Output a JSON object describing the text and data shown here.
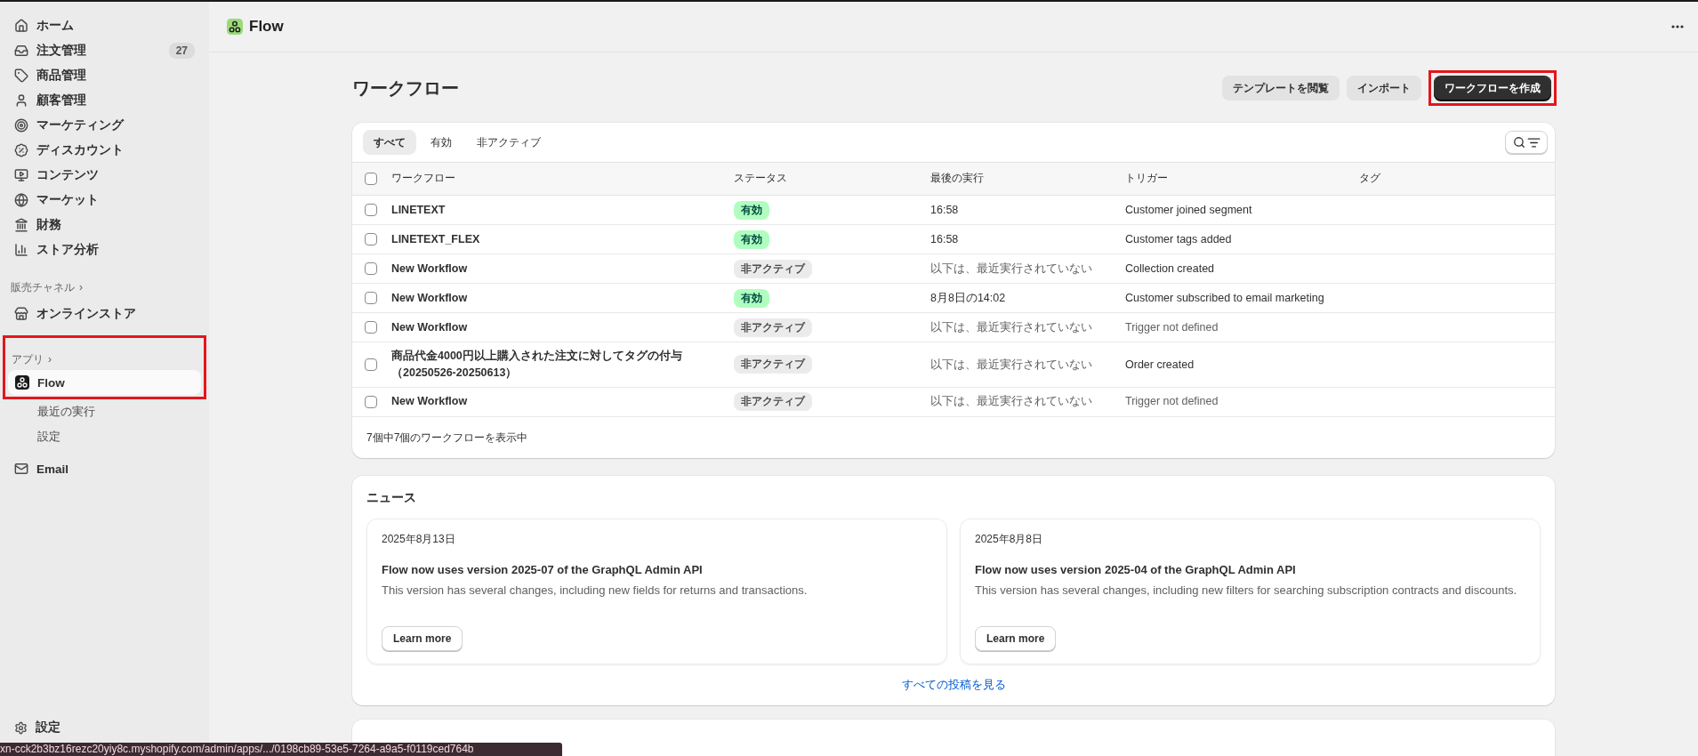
{
  "sidebar": {
    "items": [
      {
        "label": "ホーム"
      },
      {
        "label": "注文管理",
        "badge": "27"
      },
      {
        "label": "商品管理"
      },
      {
        "label": "顧客管理"
      },
      {
        "label": "マーケティング"
      },
      {
        "label": "ディスカウント"
      },
      {
        "label": "コンテンツ"
      },
      {
        "label": "マーケット"
      },
      {
        "label": "財務"
      },
      {
        "label": "ストア分析"
      }
    ],
    "sales_channels": {
      "title": "販売チャネル",
      "chevron": "›",
      "items": [
        {
          "label": "オンラインストア"
        }
      ]
    },
    "apps": {
      "title": "アプリ",
      "chevron": "›",
      "highlighted": true,
      "items": [
        {
          "label": "Flow",
          "selected": true,
          "children": [
            {
              "label": "最近の実行"
            },
            {
              "label": "設定"
            }
          ]
        }
      ]
    },
    "extra_items": [
      {
        "label": "Email"
      }
    ],
    "settings": {
      "label": "設定"
    }
  },
  "header": {
    "app_title": "Flow"
  },
  "page": {
    "title": "ワークフロー",
    "actions": [
      {
        "label": "テンプレートを閲覧",
        "kind": "secondary",
        "highlighted": false
      },
      {
        "label": "インポート",
        "kind": "secondary",
        "highlighted": false
      },
      {
        "label": "ワークフローを作成",
        "kind": "primary",
        "highlighted": true
      }
    ]
  },
  "tabs": [
    {
      "label": "すべて",
      "selected": true
    },
    {
      "label": "有効",
      "selected": false
    },
    {
      "label": "非アクティブ",
      "selected": false
    }
  ],
  "table": {
    "select_all_checked": false,
    "columns": [
      "ワークフロー",
      "ステータス",
      "最後の実行",
      "トリガー",
      "タグ"
    ],
    "rows": [
      {
        "checked": false,
        "name": "LINETEXT",
        "status": {
          "label": "有効",
          "kind": "active"
        },
        "last_run": {
          "text": "16:58",
          "muted": false
        },
        "trigger": {
          "text": "Customer joined segment",
          "muted": false
        }
      },
      {
        "checked": false,
        "name": "LINETEXT_FLEX",
        "status": {
          "label": "有効",
          "kind": "active"
        },
        "last_run": {
          "text": "16:58",
          "muted": false
        },
        "trigger": {
          "text": "Customer tags added",
          "muted": false
        }
      },
      {
        "checked": false,
        "name": "New Workflow",
        "status": {
          "label": "非アクティブ",
          "kind": "inactive"
        },
        "last_run": {
          "text": "以下は、最近実行されていない",
          "muted": true
        },
        "trigger": {
          "text": "Collection created",
          "muted": false
        }
      },
      {
        "checked": false,
        "name": "New Workflow",
        "status": {
          "label": "有効",
          "kind": "active"
        },
        "last_run": {
          "text": "8月8日の14:02",
          "muted": false
        },
        "trigger": {
          "text": "Customer subscribed to email marketing",
          "muted": false
        }
      },
      {
        "checked": false,
        "name": "New Workflow",
        "status": {
          "label": "非アクティブ",
          "kind": "inactive"
        },
        "last_run": {
          "text": "以下は、最近実行されていない",
          "muted": true
        },
        "trigger": {
          "text": "Trigger not defined",
          "muted": true
        }
      },
      {
        "checked": false,
        "name": "商品代金4000円以上購入された注文に対してタグの付与（20250526-20250613）",
        "status": {
          "label": "非アクティブ",
          "kind": "inactive"
        },
        "last_run": {
          "text": "以下は、最近実行されていない",
          "muted": true
        },
        "trigger": {
          "text": "Order created",
          "muted": false
        }
      },
      {
        "checked": false,
        "name": "New Workflow",
        "status": {
          "label": "非アクティブ",
          "kind": "inactive"
        },
        "last_run": {
          "text": "以下は、最近実行されていない",
          "muted": true
        },
        "trigger": {
          "text": "Trigger not defined",
          "muted": true
        }
      }
    ],
    "footer": "7個中7個のワークフローを表示中"
  },
  "news": {
    "title": "ニュース",
    "posts": [
      {
        "date": "2025年8月13日",
        "title": "Flow now uses version 2025-07 of the GraphQL Admin API",
        "body": "This version has several changes, including new fields for returns and transactions.",
        "button": "Learn more"
      },
      {
        "date": "2025年8月8日",
        "title": "Flow now uses version 2025-04 of the GraphQL Admin API",
        "body": "This version has several changes, including new filters for searching subscription contracts and discounts.",
        "button": "Learn more"
      }
    ],
    "link": "すべての投稿を見る"
  },
  "status_url": "xn-cck2b3bz16rezc20yiy8c.myshopify.com/admin/apps/.../0198cb89-53e5-7264-a9a5-f0119ced764b"
}
